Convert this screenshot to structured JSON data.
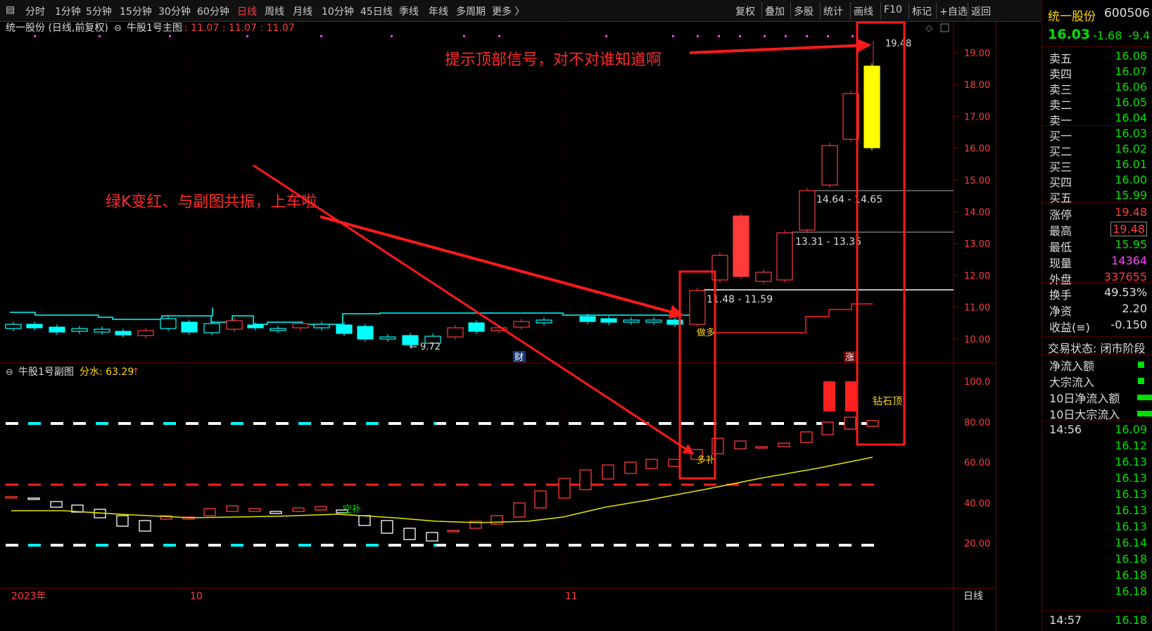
{
  "toolbar": {
    "items": [
      "分时",
      "1分钟",
      "5分钟",
      "15分钟",
      "30分钟",
      "60分钟",
      "日线",
      "周线",
      "月线",
      "10分钟",
      "45日线",
      "季线",
      "年线",
      "多周期",
      "更多 〉"
    ],
    "active_index": 6,
    "right_items": [
      "复权",
      "叠加",
      "多股",
      "统计",
      "画线",
      "F10",
      "标记",
      "+自选",
      "返回"
    ]
  },
  "main_chart": {
    "title": "统一股份 (日线,前复权)",
    "indicator": "牛股1号主图",
    "indicator_values": ": 11.07 : 11.07 : 11.07",
    "price_axis": [
      "19.00",
      "18.00",
      "17.00",
      "16.00",
      "15.00",
      "14.00",
      "13.00",
      "12.00",
      "11.00",
      "10.00"
    ],
    "labels": {
      "high_label": "19.48",
      "low_label": "← 9.72",
      "range1": "14.64 - 14.65",
      "range2": "13.31 - 13.35",
      "range3": "11.48 - 11.59",
      "cai": "财",
      "zhang": "涨",
      "duo_label": "做多"
    },
    "annotation_top": "提示顶部信号，对不对谁知道啊",
    "annotation_mid": "绿K变红、与副图共振，上车啦"
  },
  "sub_chart": {
    "title": "牛股1号副图",
    "indicator_label": "分水: 63.29",
    "axis": [
      "100.0",
      "80.00",
      "60.00",
      "40.00",
      "20.00"
    ],
    "labels": {
      "kongbu": "空补",
      "duobu": "多补",
      "zuanshiding": "钻石顶"
    }
  },
  "time_axis": {
    "labels": [
      "2023年",
      "10",
      "11"
    ],
    "period": "日线"
  },
  "quote_panel": {
    "stock_name": "统一股份",
    "stock_code": "600506",
    "price": "16.03",
    "change": "-1.68",
    "change_pct": "-9.4",
    "asks": [
      {
        "label": "卖五",
        "price": "16.08"
      },
      {
        "label": "卖四",
        "price": "16.07"
      },
      {
        "label": "卖三",
        "price": "16.06"
      },
      {
        "label": "卖二",
        "price": "16.05"
      },
      {
        "label": "卖一",
        "price": "16.04"
      }
    ],
    "bids": [
      {
        "label": "买一",
        "price": "16.03"
      },
      {
        "label": "买二",
        "price": "16.02"
      },
      {
        "label": "买三",
        "price": "16.01"
      },
      {
        "label": "买四",
        "price": "16.00"
      },
      {
        "label": "买五",
        "price": "15.99"
      }
    ],
    "stats": [
      {
        "label": "涨停",
        "value": "19.48",
        "color": "red"
      },
      {
        "label": "最高",
        "value": "19.48",
        "color": "red"
      },
      {
        "label": "最低",
        "value": "15.95",
        "color": "green"
      },
      {
        "label": "现量",
        "value": "14364",
        "color": "purple"
      },
      {
        "label": "外盘",
        "value": "337655",
        "color": "red"
      }
    ],
    "stats2": [
      {
        "label": "换手",
        "value": "49.53%"
      },
      {
        "label": "净资",
        "value": "2.20"
      },
      {
        "label": "收益(≡)",
        "value": "-0.150"
      }
    ],
    "trade_status": "交易状态: 闭市阶段",
    "flows": [
      "净流入额",
      "大宗流入",
      "10日净流入额",
      "10日大宗流入"
    ],
    "ticks": [
      {
        "time": "14:56",
        "price": "16.09"
      },
      {
        "time": "",
        "price": "16.12"
      },
      {
        "time": "",
        "price": "16.13"
      },
      {
        "time": "",
        "price": "16.13"
      },
      {
        "time": "",
        "price": "16.13"
      },
      {
        "time": "",
        "price": "16.13"
      },
      {
        "time": "",
        "price": "16.13"
      },
      {
        "time": "",
        "price": "16.14"
      },
      {
        "time": "",
        "price": "16.18"
      },
      {
        "time": "",
        "price": "16.18"
      },
      {
        "time": "",
        "price": "16.18"
      }
    ],
    "last_time": "14:57",
    "last_price": "16.18"
  }
}
